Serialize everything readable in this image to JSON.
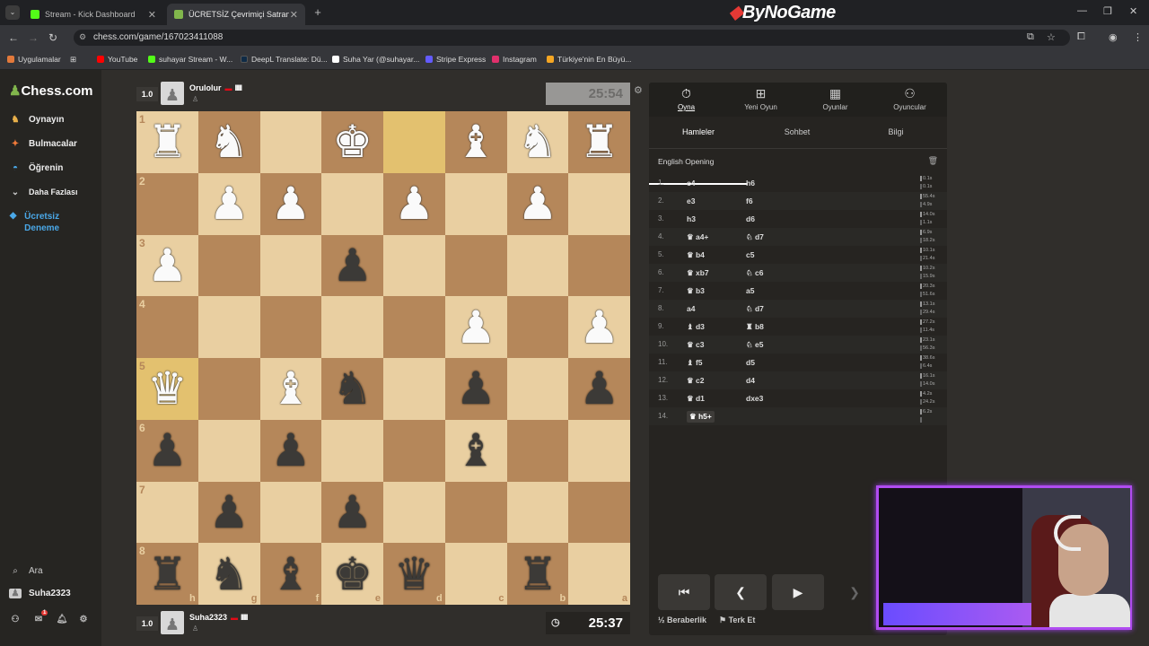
{
  "browser": {
    "tabs": [
      {
        "title": "Stream - Kick Dashboard",
        "icon": "kick-icon",
        "color": "#53fc18"
      },
      {
        "title": "ÜCRETSİZ Çevrimiçi Satranç Oy...",
        "icon": "chess-pawn-icon",
        "color": "#81b64c"
      }
    ],
    "brand": "ByNoGame",
    "url": "chess.com/game/167023411088",
    "bookmarks": [
      {
        "label": "Uygulamalar",
        "color": "#e2793b"
      },
      {
        "label": "YouTube",
        "color": "#ff0000"
      },
      {
        "label": "suhayar Stream - W...",
        "color": "#53fc18"
      },
      {
        "label": "DeepL Translate: Dü...",
        "color": "#0f2b46"
      },
      {
        "label": "Suha Yar (@suhayar...",
        "color": "#ffffff"
      },
      {
        "label": "Stripe Express",
        "color": "#635bff"
      },
      {
        "label": "Instagram",
        "color": "#e1306c"
      },
      {
        "label": "Türkiye'nin En Büyü...",
        "color": "#f5a623"
      }
    ]
  },
  "sidebar": {
    "logo_prefix": "♟",
    "logo_text": "Chess.com",
    "items": [
      {
        "label": "Oynayın",
        "icon": "play-icon"
      },
      {
        "label": "Bulmacalar",
        "icon": "puzzle-icon"
      },
      {
        "label": "Öğrenin",
        "icon": "learn-icon"
      },
      {
        "label": "Daha Fazlası",
        "icon": "chevron-down-icon"
      },
      {
        "label": "Ücretsiz Deneme",
        "icon": "diamond-icon"
      }
    ],
    "search_label": "Ara",
    "username": "Suha2323",
    "notification_count": "1"
  },
  "players": {
    "top": {
      "rating": "1.0",
      "name": "Orulolur",
      "flag": "▬",
      "bars": "IIIII",
      "clock": "25:54"
    },
    "bottom": {
      "rating": "1.0",
      "name": "Suha2323",
      "flag": "▬",
      "bars": "IIIII",
      "clock": "25:37"
    }
  },
  "board": {
    "orientation": "black",
    "ranks": [
      "1",
      "2",
      "3",
      "4",
      "5",
      "6",
      "7",
      "8"
    ],
    "files": [
      "h",
      "g",
      "f",
      "e",
      "d",
      "c",
      "b",
      "a"
    ],
    "highlights": [
      [
        0,
        4
      ],
      [
        4,
        0
      ]
    ],
    "rows": [
      [
        "wR",
        "wN",
        "",
        "wK",
        "",
        "wB",
        "wN",
        "wR"
      ],
      [
        "",
        "wP",
        "wP",
        "",
        "wP",
        "",
        "wP",
        ""
      ],
      [
        "wP",
        "",
        "",
        "bP",
        "",
        "",
        "",
        ""
      ],
      [
        "",
        "",
        "",
        "",
        "",
        "wP",
        "",
        "wP"
      ],
      [
        "wQ",
        "",
        "wB",
        "bN",
        "",
        "bP",
        "",
        "bP"
      ],
      [
        "bP",
        "",
        "bP",
        "",
        "",
        "bB",
        "",
        ""
      ],
      [
        "",
        "bP",
        "",
        "bP",
        "",
        "",
        "",
        ""
      ],
      [
        "bR",
        "bN",
        "bB",
        "bK",
        "bQ",
        "",
        "bR",
        ""
      ]
    ]
  },
  "panel": {
    "tabs": [
      {
        "label": "Oyna",
        "icon": "stopwatch-icon"
      },
      {
        "label": "Yeni Oyun",
        "icon": "plus-icon"
      },
      {
        "label": "Oyunlar",
        "icon": "board-icon"
      },
      {
        "label": "Oyuncular",
        "icon": "players-icon"
      }
    ],
    "subtabs": [
      "Hamleler",
      "Sohbet",
      "Bilgi"
    ],
    "opening": "English Opening",
    "moves": [
      {
        "n": "1.",
        "w": "c4",
        "b": "h6",
        "tw": "0.1s",
        "tb": "0.1s"
      },
      {
        "n": "2.",
        "w": "e3",
        "b": "f6",
        "tw": "55.4s",
        "tb": "4.9s"
      },
      {
        "n": "3.",
        "w": "h3",
        "b": "d6",
        "tw": "14.0s",
        "tb": "1.1s"
      },
      {
        "n": "4.",
        "w": "♛ a4+",
        "b": "♘ d7",
        "tw": "6.9s",
        "tb": "18.2s"
      },
      {
        "n": "5.",
        "w": "♛ b4",
        "b": "c5",
        "tw": "10.1s",
        "tb": "21.4s"
      },
      {
        "n": "6.",
        "w": "♛ xb7",
        "b": "♘ c6",
        "tw": "10.2s",
        "tb": "15.9s"
      },
      {
        "n": "7.",
        "w": "♛ b3",
        "b": "a5",
        "tw": "20.3s",
        "tb": "51.6s"
      },
      {
        "n": "8.",
        "w": "a4",
        "b": "♘ d7",
        "tw": "13.1s",
        "tb": "29.4s"
      },
      {
        "n": "9.",
        "w": "♝ d3",
        "b": "♜ b8",
        "tw": "27.2s",
        "tb": "11.4s"
      },
      {
        "n": "10.",
        "w": "♛ c3",
        "b": "♘ e5",
        "tw": "23.1s",
        "tb": "56.3s"
      },
      {
        "n": "11.",
        "w": "♝ f5",
        "b": "d5",
        "tw": "38.6s",
        "tb": "6.4s"
      },
      {
        "n": "12.",
        "w": "♛ c2",
        "b": "d4",
        "tw": "16.1s",
        "tb": "14.0s"
      },
      {
        "n": "13.",
        "w": "♛ d1",
        "b": "dxe3",
        "tw": "4.2s",
        "tb": "24.2s"
      },
      {
        "n": "14.",
        "w": "♛ h5+",
        "b": "",
        "tw": "6.2s",
        "tb": ""
      }
    ],
    "draw_label": "Beraberlik",
    "resign_label": "Terk Et"
  }
}
